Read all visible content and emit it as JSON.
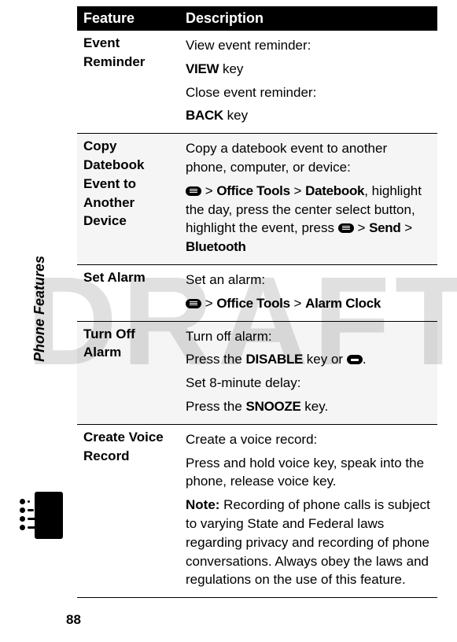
{
  "watermark": "DRAFT",
  "sideLabel": "Phone Features",
  "pageNumber": "88",
  "table": {
    "headers": {
      "feature": "Feature",
      "description": "Description"
    },
    "rows": [
      {
        "feature": "Event Reminder",
        "desc": {
          "p1": "View event reminder:",
          "view": "VIEW",
          "keyTxt1": " key",
          "p2": "Close event reminder:",
          "back": "BACK",
          "keyTxt2": " key"
        }
      },
      {
        "feature": "Copy Datebook Event to Another Device",
        "desc": {
          "p1": "Copy a datebook event to another phone, computer, or device:",
          "gt1": " > ",
          "ot": "Office Tools",
          "gt2": " > ",
          "db": "Datebook",
          "mid": ", highlight the day, press the center select button, highlight the event, press ",
          "gt3": " > ",
          "send": "Send",
          "gt4": " > ",
          "bt": "Bluetooth"
        }
      },
      {
        "feature": "Set Alarm",
        "desc": {
          "p1": "Set an alarm:",
          "gt1": " > ",
          "ot": "Office Tools",
          "gt2": " > ",
          "ac": "Alarm Clock"
        }
      },
      {
        "feature": "Turn Off Alarm",
        "desc": {
          "p1": "Turn off alarm:",
          "press1": "Press the ",
          "disable": "DISABLE",
          "keyor": " key or ",
          "dot": ".",
          "p2": "Set 8-minute delay:",
          "press2": "Press the ",
          "snooze": "SNOOZE",
          "keyTxt": " key."
        }
      },
      {
        "feature": "Create Voice Record",
        "desc": {
          "p1": "Create a voice record:",
          "p2": "Press and hold voice key, speak into the phone, release voice key.",
          "noteLabel": "Note: ",
          "noteBody": "Recording of phone calls is subject to varying State and Federal laws regarding privacy and recording of phone conversations. Always obey the laws and regulations on the use of this feature."
        }
      }
    ]
  }
}
